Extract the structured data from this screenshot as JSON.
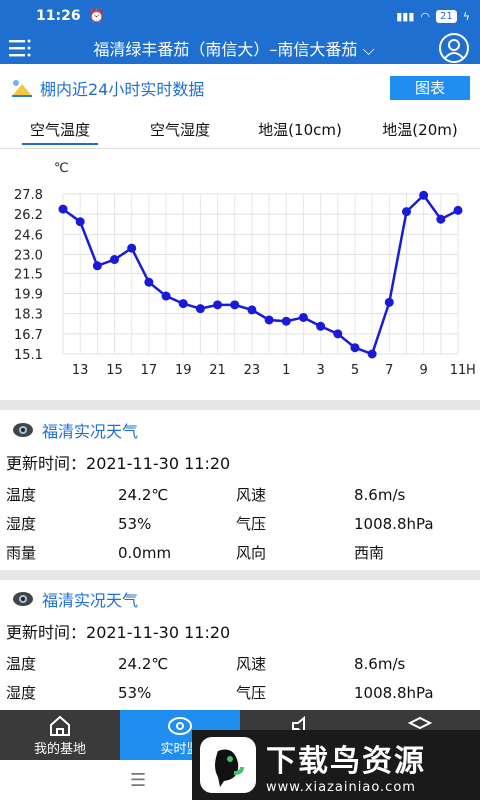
{
  "status_bar": {
    "time": "11:26",
    "battery": "21"
  },
  "app_bar": {
    "title": "福清绿丰番茄（南信大）–南信大番茄"
  },
  "section": {
    "title": "棚内近24小时实时数据",
    "chart_button": "图表"
  },
  "tabs": [
    {
      "label": "空气温度",
      "active": true
    },
    {
      "label": "空气湿度",
      "active": false
    },
    {
      "label": "地温(10cm)",
      "active": false
    },
    {
      "label": "地温(20m)",
      "active": false
    }
  ],
  "chart_data": {
    "type": "line",
    "unit_label": "℃",
    "x_suffix": "H",
    "x": [
      "12",
      "13",
      "14",
      "15",
      "16",
      "17",
      "18",
      "19",
      "20",
      "21",
      "22",
      "23",
      "0",
      "1",
      "2",
      "3",
      "4",
      "5",
      "6",
      "7",
      "8",
      "9",
      "10",
      "11"
    ],
    "x_tick_labels": [
      "13",
      "15",
      "17",
      "19",
      "21",
      "23",
      "1",
      "3",
      "5",
      "7",
      "9",
      "11"
    ],
    "y_ticks": [
      "27.8",
      "26.2",
      "24.6",
      "23.0",
      "21.5",
      "19.9",
      "18.3",
      "16.7",
      "15.1"
    ],
    "ylim": [
      15.1,
      27.8
    ],
    "series": [
      {
        "values": [
          26.6,
          25.6,
          22.1,
          22.6,
          23.5,
          20.8,
          19.7,
          19.1,
          18.7,
          19.0,
          19.0,
          18.6,
          17.8,
          17.7,
          18.0,
          17.3,
          16.7,
          15.6,
          15.1,
          19.2,
          26.4,
          27.7,
          25.8,
          26.5
        ]
      }
    ],
    "color": "#1a1adb",
    "grid": true
  },
  "weather_blocks": [
    {
      "title": "福清实况天气",
      "update_label": "更新时间：",
      "update_time": "2021-11-30 11:20",
      "rows": [
        {
          "k1": "温度",
          "v1": "24.2℃",
          "k2": "风速",
          "v2": "8.6m/s"
        },
        {
          "k1": "湿度",
          "v1": "53%",
          "k2": "气压",
          "v2": "1008.8hPa"
        },
        {
          "k1": "雨量",
          "v1": "0.0mm",
          "k2": "风向",
          "v2": "西南"
        }
      ]
    },
    {
      "title": "福清实况天气",
      "update_label": "更新时间：",
      "update_time": "2021-11-30 11:20",
      "rows": [
        {
          "k1": "温度",
          "v1": "24.2℃",
          "k2": "风速",
          "v2": "8.6m/s"
        },
        {
          "k1": "湿度",
          "v1": "53%",
          "k2": "气压",
          "v2": "1008.8hPa"
        }
      ]
    }
  ],
  "bottom_nav": [
    {
      "label": "我的基地",
      "icon": "home-icon",
      "active": false
    },
    {
      "label": "实时监",
      "icon": "monitor-icon",
      "active": true
    },
    {
      "label": "",
      "icon": "speaker-icon",
      "active": false
    },
    {
      "label": "",
      "icon": "layers-icon",
      "active": false
    }
  ],
  "watermark": {
    "title": "下载鸟资源",
    "url": "www.xiazainiao.com"
  }
}
